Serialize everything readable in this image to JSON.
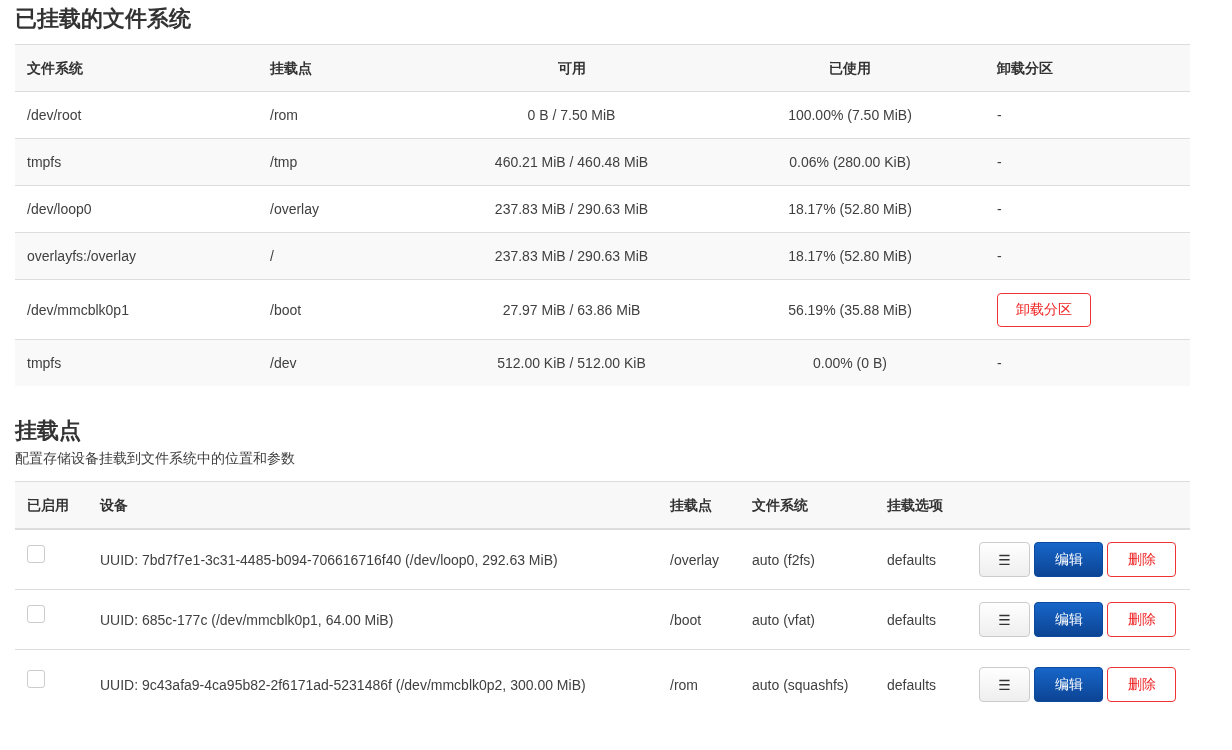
{
  "mounted": {
    "title": "已挂载的文件系统",
    "columns": [
      "文件系统",
      "挂载点",
      "可用",
      "已使用",
      "卸载分区"
    ],
    "rows": [
      {
        "filesystem": "/dev/root",
        "mount_point": "/rom",
        "available": "0 B / 7.50 MiB",
        "used": "100.00% (7.50 MiB)",
        "unmount": {
          "kind": "text",
          "label": "-"
        }
      },
      {
        "filesystem": "tmpfs",
        "mount_point": "/tmp",
        "available": "460.21 MiB / 460.48 MiB",
        "used": "0.06% (280.00 KiB)",
        "unmount": {
          "kind": "text",
          "label": "-"
        }
      },
      {
        "filesystem": "/dev/loop0",
        "mount_point": "/overlay",
        "available": "237.83 MiB / 290.63 MiB",
        "used": "18.17% (52.80 MiB)",
        "unmount": {
          "kind": "text",
          "label": "-"
        }
      },
      {
        "filesystem": "overlayfs:/overlay",
        "mount_point": "/",
        "available": "237.83 MiB / 290.63 MiB",
        "used": "18.17% (52.80 MiB)",
        "unmount": {
          "kind": "text",
          "label": "-"
        }
      },
      {
        "filesystem": "/dev/mmcblk0p1",
        "mount_point": "/boot",
        "available": "27.97 MiB / 63.86 MiB",
        "used": "56.19% (35.88 MiB)",
        "unmount": {
          "kind": "button",
          "label": "卸载分区"
        }
      },
      {
        "filesystem": "tmpfs",
        "mount_point": "/dev",
        "available": "512.00 KiB / 512.00 KiB",
        "used": "0.00% (0 B)",
        "unmount": {
          "kind": "text",
          "label": "-"
        }
      }
    ]
  },
  "mount_points": {
    "title": "挂载点",
    "description": "配置存储设备挂载到文件系统中的位置和参数",
    "columns": [
      "已启用",
      "设备",
      "挂载点",
      "文件系统",
      "挂载选项"
    ],
    "rows": [
      {
        "enabled": false,
        "device": "UUID: 7bd7f7e1-3c31-4485-b094-706616716f40 (/dev/loop0, 292.63 MiB)",
        "mount_point": "/overlay",
        "filesystem": "auto (f2fs)",
        "options": "defaults",
        "menu": "☰",
        "edit": "编辑",
        "delete": "删除"
      },
      {
        "enabled": false,
        "device": "UUID: 685c-177c (/dev/mmcblk0p1, 64.00 MiB)",
        "mount_point": "/boot",
        "filesystem": "auto (vfat)",
        "options": "defaults",
        "menu": "☰",
        "edit": "编辑",
        "delete": "删除"
      },
      {
        "enabled": false,
        "device": "UUID: 9c43afa9-4ca95b82-2f6171ad-5231486f (/dev/mmcblk0p2, 300.00 MiB)",
        "mount_point": "/rom",
        "filesystem": "auto (squashfs)",
        "options": "defaults",
        "menu": "☰",
        "edit": "编辑",
        "delete": "删除"
      }
    ]
  }
}
